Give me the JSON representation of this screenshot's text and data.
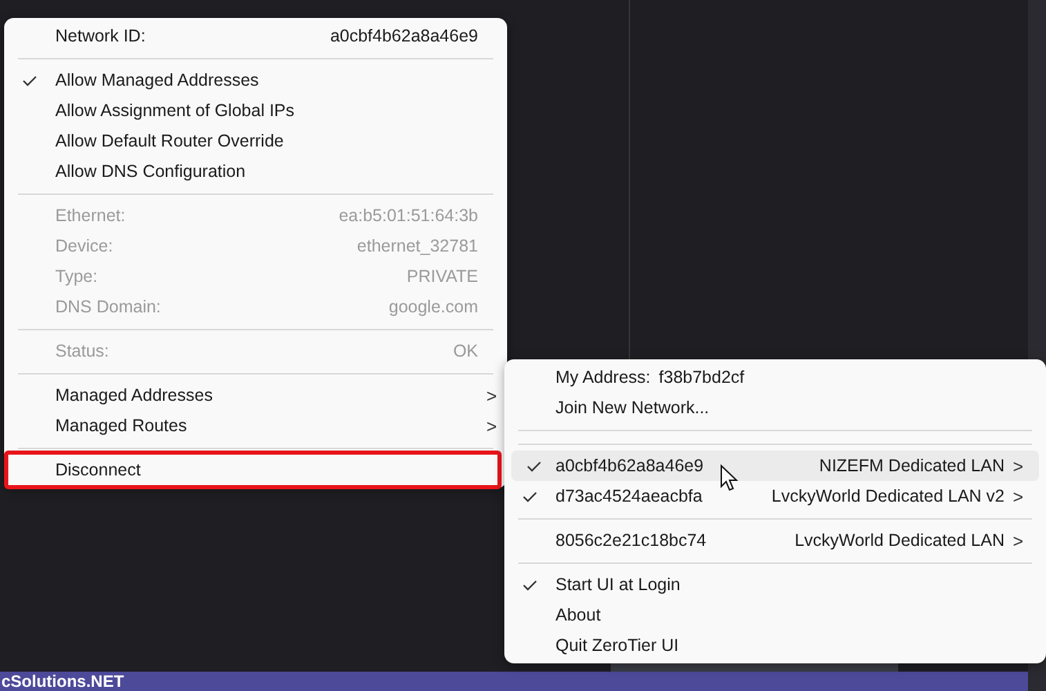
{
  "taskbar": {
    "text": "cSolutions.NET"
  },
  "network_menu": {
    "items": [
      {
        "kind": "pair",
        "label": "Network ID:",
        "value": "a0cbf4b62a8a46e9",
        "disabled": false
      },
      {
        "kind": "separator"
      },
      {
        "kind": "toggle",
        "label": "Allow Managed Addresses",
        "checked": true
      },
      {
        "kind": "toggle",
        "label": "Allow Assignment of Global IPs",
        "checked": false
      },
      {
        "kind": "toggle",
        "label": "Allow Default Router Override",
        "checked": false
      },
      {
        "kind": "toggle",
        "label": "Allow DNS Configuration",
        "checked": false
      },
      {
        "kind": "separator"
      },
      {
        "kind": "pair",
        "label": "Ethernet:",
        "value": "ea:b5:01:51:64:3b",
        "disabled": true
      },
      {
        "kind": "pair",
        "label": "Device:",
        "value": "ethernet_32781",
        "disabled": true
      },
      {
        "kind": "pair",
        "label": "Type:",
        "value": "PRIVATE",
        "disabled": true
      },
      {
        "kind": "pair",
        "label": "DNS Domain:",
        "value": "google.com",
        "disabled": true
      },
      {
        "kind": "separator"
      },
      {
        "kind": "pair",
        "label": "Status:",
        "value": "OK",
        "disabled": true
      },
      {
        "kind": "separator"
      },
      {
        "kind": "submenu",
        "label": "Managed Addresses",
        "arrow": ">"
      },
      {
        "kind": "submenu",
        "label": "Managed Routes",
        "arrow": ">"
      },
      {
        "kind": "separator"
      },
      {
        "kind": "action",
        "label": "Disconnect",
        "outlined": true
      }
    ]
  },
  "main_menu": {
    "items": [
      {
        "kind": "pair",
        "label": "My Address:",
        "value": "f38b7bd2cf",
        "disabled": false
      },
      {
        "kind": "action",
        "label": "Join New Network...",
        "outlined": false
      },
      {
        "kind": "separator"
      },
      {
        "kind": "separator"
      },
      {
        "kind": "network",
        "id": "a0cbf4b62a8a46e9",
        "name": "NIZEFM Dedicated LAN",
        "arrow": ">",
        "checked": true,
        "hovered": true
      },
      {
        "kind": "network",
        "id": "d73ac4524aeacbfa",
        "name": "LvckyWorld Dedicated LAN v2",
        "arrow": ">",
        "checked": true,
        "hovered": false
      },
      {
        "kind": "separator"
      },
      {
        "kind": "network",
        "id": "8056c2e21c18bc74",
        "name": "LvckyWorld Dedicated LAN",
        "arrow": ">",
        "checked": false,
        "hovered": false
      },
      {
        "kind": "separator"
      },
      {
        "kind": "toggle",
        "label": "Start UI at Login",
        "checked": true
      },
      {
        "kind": "action",
        "label": "About",
        "outlined": false
      },
      {
        "kind": "action",
        "label": "Quit ZeroTier UI",
        "outlined": false
      }
    ]
  }
}
